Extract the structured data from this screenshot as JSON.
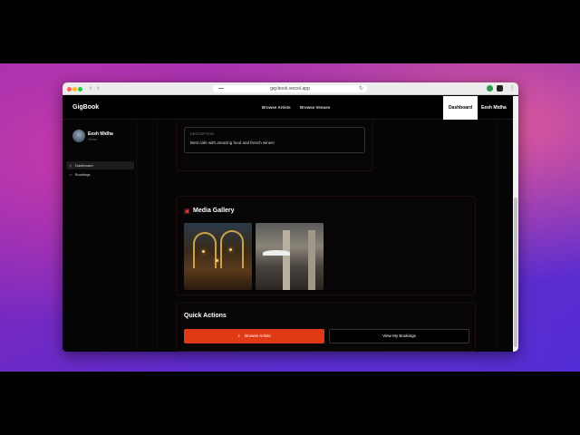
{
  "browser": {
    "url": "gig-book.vercel.app",
    "back_icon": "chevron-left-icon",
    "forward_icon": "chevron-right-icon"
  },
  "topbar": {
    "brand": "GigBook",
    "nav": [
      "Browse Artists",
      "Browse Venues"
    ],
    "dashboard_label": "Dashboard",
    "user_name": "Eesh Midha"
  },
  "sidebar": {
    "user_name": "Eesh Midha",
    "user_role": "Venue",
    "items": [
      {
        "label": "Dashboard",
        "icon": "grid-icon",
        "active": true
      },
      {
        "label": "Bookings",
        "icon": "calendar-icon",
        "active": false
      }
    ]
  },
  "venue": {
    "description_label": "DESCRIPTION",
    "description": "Best cafe with amazing food and french wines!"
  },
  "media": {
    "title": "Media Gallery",
    "icon": "gallery-icon"
  },
  "actions": {
    "title": "Quick Actions",
    "browse_label": "Browse Artists",
    "bookings_label": "View My Bookings"
  },
  "colors": {
    "accent": "#e03a14",
    "background": "#050505"
  }
}
